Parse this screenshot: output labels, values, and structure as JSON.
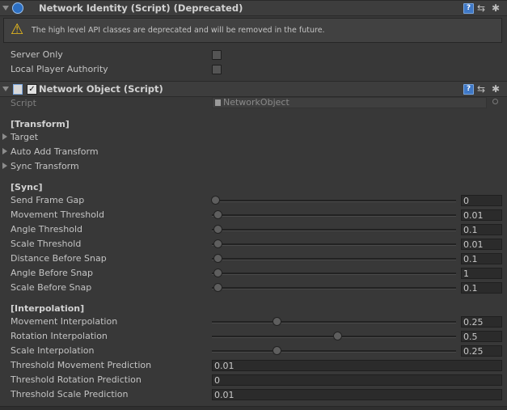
{
  "network_identity": {
    "title": "Network Identity (Script) (Deprecated)",
    "warning": "The high level API classes are deprecated and will be removed in the future.",
    "fields": [
      {
        "label": "Server Only",
        "checked": false
      },
      {
        "label": "Local Player Authority",
        "checked": false
      }
    ]
  },
  "network_object": {
    "title": "Network Object (Script)",
    "enabled": true,
    "script_label": "Script",
    "script_value": "NetworkObject",
    "transform_section": "[Transform]",
    "transform_items": [
      "Target",
      "Auto Add Transform",
      "Sync Transform"
    ],
    "sync_section": "[Sync]",
    "sync_fields": [
      {
        "label": "Send Frame Gap",
        "value": "0",
        "fraction": 0
      },
      {
        "label": "Movement Threshold",
        "value": "0.01",
        "fraction": 0.01
      },
      {
        "label": "Angle Threshold",
        "value": "0.1",
        "fraction": 0.01
      },
      {
        "label": "Scale Threshold",
        "value": "0.01",
        "fraction": 0.01
      },
      {
        "label": "Distance Before Snap",
        "value": "0.1",
        "fraction": 0.01
      },
      {
        "label": "Angle Before Snap",
        "value": "1",
        "fraction": 0.01
      },
      {
        "label": "Scale Before Snap",
        "value": "0.1",
        "fraction": 0.01
      }
    ],
    "interp_section": "[Interpolation]",
    "interp_fields": [
      {
        "label": "Movement Interpolation",
        "value": "0.25",
        "fraction": 0.25
      },
      {
        "label": "Rotation Interpolation",
        "value": "0.5",
        "fraction": 0.5
      },
      {
        "label": "Scale Interpolation",
        "value": "0.25",
        "fraction": 0.25
      }
    ],
    "prediction_fields": [
      {
        "label": "Threshold Movement Prediction",
        "value": "0.01"
      },
      {
        "label": "Threshold Rotation Prediction",
        "value": "0"
      },
      {
        "label": "Threshold Scale Prediction",
        "value": "0.01"
      }
    ]
  },
  "icons": {
    "help": "?",
    "settings": "⇆",
    "gear": "✱",
    "warning": "⚠"
  }
}
